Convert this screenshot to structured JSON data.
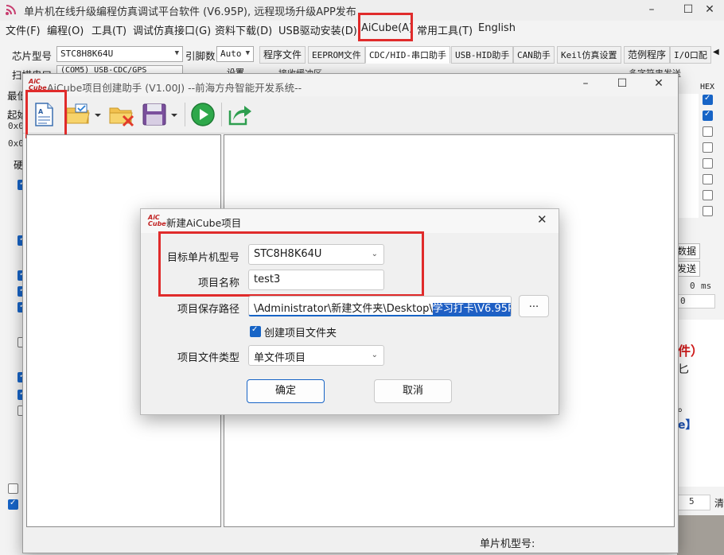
{
  "main_window": {
    "title": "单片机在线升级编程仿真调试平台软件 (V6.95P), 远程现场升级APP发布",
    "menu": [
      "文件(F)",
      "编程(O)",
      "工具(T)",
      "调试仿真接口(G)",
      "资料下载(D)",
      "USB驱动安装(D)",
      "AiCube(A)",
      "常用工具(T)",
      "English"
    ],
    "chip_label": "芯片型号",
    "chip_value": "STC8H8K64U",
    "pins_label": "引脚数",
    "pins_value": "Auto",
    "scan_label": "扫描串口",
    "port_value": "(COM5) USB-CDC/GPS",
    "settings_label": "设置",
    "row3_label": "最低",
    "start_label": "起始",
    "addr1": "0x0",
    "addr2": "0x0",
    "hw_label": "硬",
    "tabs": [
      "程序文件",
      "EEPROM文件",
      "CDC/HID-串口助手",
      "USB-HID助手",
      "CAN助手",
      "Keil仿真设置",
      "范例程序",
      "I/O口配"
    ],
    "tab_sub": "接收缓冲区",
    "right_header": "多字符串发送",
    "hex_label": "HEX",
    "side_btn1": "数据",
    "side_btn2": "发送",
    "ms_value": "0",
    "ms_unit": "ms",
    "zero_value": "0",
    "red_text": "件）",
    "text_line": "匕",
    "dot_text": "。",
    "bracket_text": "e】",
    "bottom_value": "5",
    "bottom_btn": "清"
  },
  "helper": {
    "title": "AiCube项目创建助手 (V1.00J) --前海方舟智能开发系统--",
    "status_label": "单片机型号:"
  },
  "dialog": {
    "title": "新建AiCube项目",
    "mcu_label": "目标单片机型号",
    "mcu_value": "STC8H8K64U",
    "name_label": "项目名称",
    "name_value": "test3",
    "path_label": "项目保存路径",
    "path_value": "\\Administrator\\新建文件夹\\Desktop\\",
    "path_selected": "学习打卡\\V6.95P",
    "browse_label": "...",
    "create_folder_label": "创建项目文件夹",
    "type_label": "项目文件类型",
    "type_value": "单文件项目",
    "ok_label": "确定",
    "cancel_label": "取消"
  },
  "logo_text": "AiC Cube",
  "colors": {
    "highlight": "#e02b2b",
    "accent": "#1764c6",
    "selection": "#1f5fc4"
  }
}
